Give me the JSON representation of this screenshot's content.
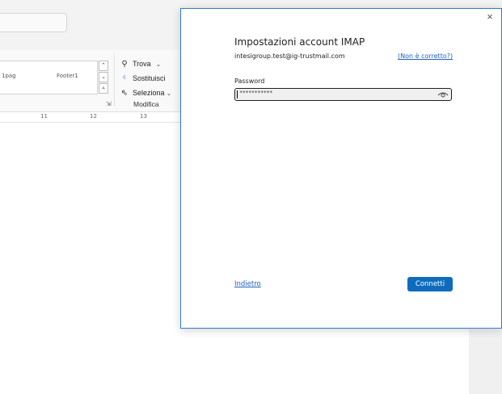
{
  "background": {
    "styles": [
      "1pag",
      "Footer1"
    ],
    "editing": {
      "find_label": "Trova",
      "replace_label": "Sostituisci",
      "select_label": "Seleziona",
      "group_label": "Modifica"
    },
    "ruler_ticks": [
      "11",
      "12",
      "13"
    ]
  },
  "dialog": {
    "title": "Impostazioni account IMAP",
    "email": "intesigroup.test@ig-trustmail.com",
    "not_correct_link": "(Non è corretto?)",
    "password_label": "Password",
    "password_value": "***********",
    "back_link": "Indietro",
    "connect_button": "Connetti",
    "close_glyph": "×"
  },
  "colors": {
    "accent": "#0f6cbd",
    "link": "#1f5fbf",
    "dialog_border": "#2f7ad6"
  }
}
